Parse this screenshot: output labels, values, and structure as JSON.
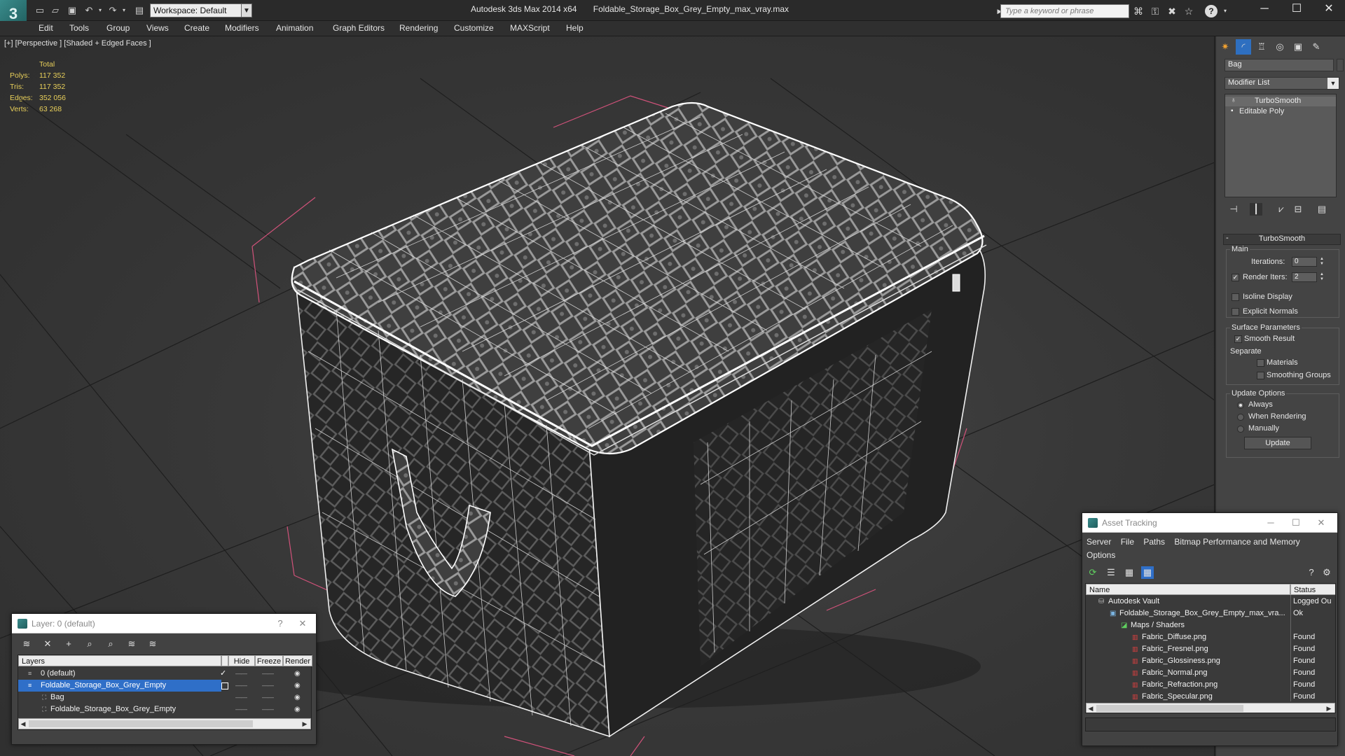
{
  "titlebar": {
    "app_logo": "3",
    "workspace": "Workspace: Default",
    "app_name": "Autodesk 3ds Max  2014 x64",
    "file_name": "Foldable_Storage_Box_Grey_Empty_max_vray.max",
    "search_placeholder": "Type a keyword or phrase",
    "help": "?"
  },
  "menu": [
    "Edit",
    "Tools",
    "Group",
    "Views",
    "Create",
    "Modifiers",
    "Animation",
    "Graph Editors",
    "Rendering",
    "Customize",
    "MAXScript",
    "Help"
  ],
  "viewport": {
    "label": "[+] [Perspective ] [Shaded + Edged Faces ]",
    "stats_header": "Total",
    "stats": [
      {
        "label": "Polys:",
        "value": "117 352"
      },
      {
        "label": "Tris:",
        "value": "117 352"
      },
      {
        "label": "Edges:",
        "value": "352 056"
      },
      {
        "label": "Verts:",
        "value": "63 268"
      }
    ]
  },
  "command_panel": {
    "object_name": "Bag",
    "modifier_list": "Modifier List",
    "stack": [
      "TurboSmooth",
      "Editable Poly"
    ],
    "rollout_title": "TurboSmooth",
    "main_group": "Main",
    "iterations_label": "Iterations:",
    "iterations_value": "0",
    "render_iters_label": "Render Iters:",
    "render_iters_value": "2",
    "render_iters_checked": true,
    "isoline_label": "Isoline Display",
    "explicit_normals_label": "Explicit Normals",
    "surface_group": "Surface Parameters",
    "smooth_result_label": "Smooth Result",
    "separate_label": "Separate",
    "materials_label": "Materials",
    "smoothing_groups_label": "Smoothing Groups",
    "update_group": "Update Options",
    "update_options": [
      "Always",
      "When Rendering",
      "Manually"
    ],
    "update_selected": 0,
    "update_button": "Update"
  },
  "layer_panel": {
    "title": "Layer: 0 (default)",
    "help": "?",
    "columns": [
      "Layers",
      "Hide",
      "Freeze",
      "Render"
    ],
    "rows": [
      {
        "name": "0 (default)",
        "selected": false,
        "indent": 0
      },
      {
        "name": "Foldable_Storage_Box_Grey_Empty",
        "selected": true,
        "indent": 0
      },
      {
        "name": "Bag",
        "selected": false,
        "indent": 1
      },
      {
        "name": "Foldable_Storage_Box_Grey_Empty",
        "selected": false,
        "indent": 1
      }
    ]
  },
  "asset_panel": {
    "title": "Asset Tracking",
    "menu": [
      "Server",
      "File",
      "Paths",
      "Bitmap Performance and Memory"
    ],
    "menu2": "Options",
    "columns": [
      "Name",
      "Status"
    ],
    "rows": [
      {
        "name": "Autodesk Vault",
        "status": "Logged Ou",
        "indent": 0
      },
      {
        "name": "Foldable_Storage_Box_Grey_Empty_max_vra...",
        "status": "Ok",
        "indent": 1
      },
      {
        "name": "Maps / Shaders",
        "status": "",
        "indent": 2
      },
      {
        "name": "Fabric_Diffuse.png",
        "status": "Found",
        "indent": 3
      },
      {
        "name": "Fabric_Fresnel.png",
        "status": "Found",
        "indent": 3
      },
      {
        "name": "Fabric_Glossiness.png",
        "status": "Found",
        "indent": 3
      },
      {
        "name": "Fabric_Normal.png",
        "status": "Found",
        "indent": 3
      },
      {
        "name": "Fabric_Refraction.png",
        "status": "Found",
        "indent": 3
      },
      {
        "name": "Fabric_Specular.png",
        "status": "Found",
        "indent": 3
      }
    ]
  },
  "colors": {
    "stats_yellow": "#e9d05a",
    "selection_blue": "#2f6fc8",
    "bbox_pink": "#d0527a"
  }
}
